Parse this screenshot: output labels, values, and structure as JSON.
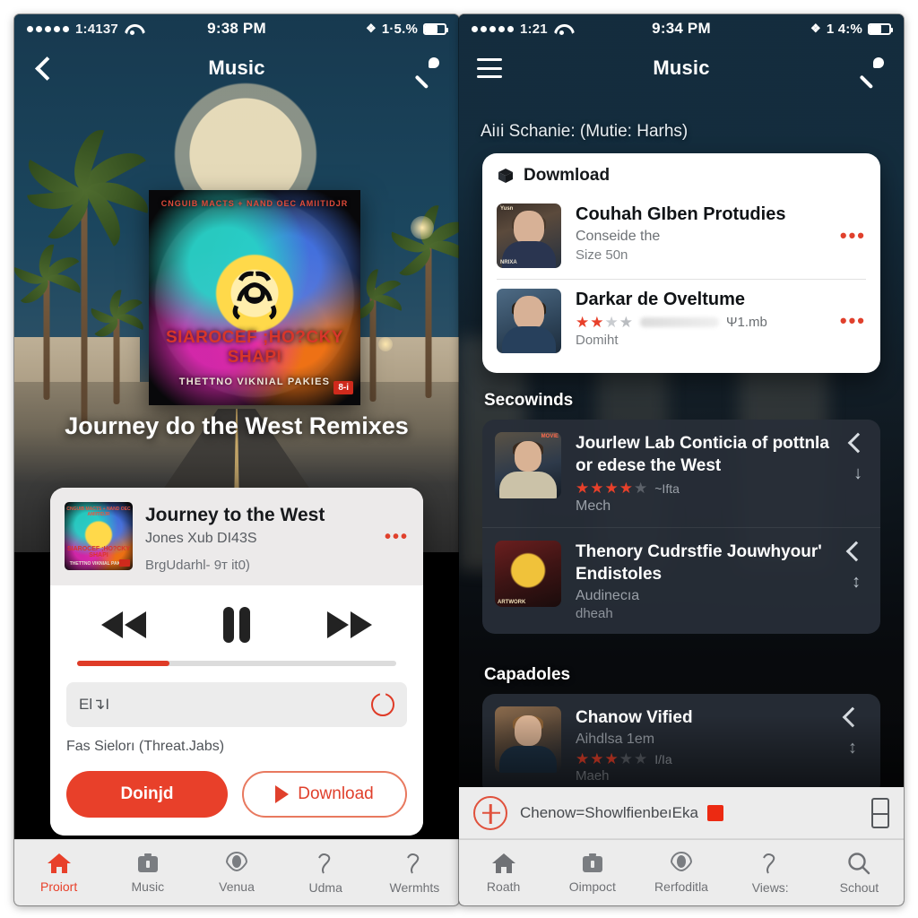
{
  "left": {
    "status": {
      "carrier": "1:4137",
      "time": "9:38 PM",
      "bluetooth": "bluetooth-icon",
      "battery_text": "1·5.%",
      "battery_level": 62
    },
    "nav": {
      "back": "back-icon",
      "title": "Music",
      "mic": "mic-icon"
    },
    "album": {
      "top_line": "CNGUIB MACTS + NAND OEC AMIITIDJR",
      "title_line": "SIAROCEF ;HO?CKY SHAPI",
      "sub_line": "THETTNO VIKNIAL PAKIES",
      "badge": "8-i"
    },
    "hero_title": "Journey do the West Remixes",
    "player": {
      "title": "Journey to the West",
      "subtitle": "Jones Xub DI43S",
      "third_line": "BrgUdarhl- 9т it0)",
      "more": "•••",
      "rewind": "rewind-icon",
      "pause": "pause-icon",
      "forward": "fast-forward-icon",
      "progress_percent": 29,
      "input_value": "El↴I",
      "power_icon": "power-icon",
      "caption": "Fas Sielorı (Threat.Jabs)",
      "primary_button": "Doinjd",
      "secondary_button": "Download"
    },
    "tabs": [
      {
        "label": "Proiort",
        "icon": "home-icon",
        "active": true
      },
      {
        "label": "Music",
        "icon": "briefcase-icon",
        "active": false
      },
      {
        "label": "Venua",
        "icon": "parachute-icon",
        "active": false
      },
      {
        "label": "Udma",
        "icon": "squiggle-icon",
        "active": false
      },
      {
        "label": "Wermhts",
        "icon": "squiggle-icon",
        "active": false
      }
    ]
  },
  "right": {
    "status": {
      "carrier": "1:21",
      "time": "9:34 PM",
      "bluetooth": "bluetooth-icon",
      "battery_text": "1 4:%",
      "battery_level": 58
    },
    "nav": {
      "menu": "hamburger-icon",
      "title": "Music",
      "mic": "mic-icon"
    },
    "caption": "Aiıi Schanie: (Mutie: Harhs)",
    "download_card": {
      "header": "Dowmload",
      "header_icon": "box-icon",
      "items": [
        {
          "title": "Couhah GIben Protudies",
          "sub": "Conseide the",
          "sub3": "Size 50n",
          "size": "",
          "stars": 0,
          "more": "•••",
          "thumb_tag": "Yusn",
          "thumb_tag2": "NRIXA"
        },
        {
          "title": "Darkar de Oveltume",
          "sub": "",
          "sub3": "Domiht",
          "size": "Ψ1.mb",
          "stars": 2,
          "more": "•••",
          "thumb_tag": "",
          "thumb_tag2": ""
        }
      ]
    },
    "sections": [
      {
        "title": "Secowinds",
        "items": [
          {
            "title": "Jourlew Lab Conticia of pottnla or edese the West",
            "sub": "Mech",
            "sub2": "",
            "stars": 4,
            "rating_text": "~Ifta",
            "thumb": "reporter-photo",
            "chev": "chevron-left-icon",
            "arrow": "↓"
          },
          {
            "title": "Thenory Cudrstfie Jouwhyour' Endistoles",
            "sub": "Audinecıa",
            "sub2": "dheah",
            "stars": 0,
            "rating_text": "",
            "thumb": "golden-deity-art",
            "chev": "chevron-left-icon",
            "arrow": "↕"
          }
        ]
      },
      {
        "title": "Capadoles",
        "items": [
          {
            "title": "Chanow Vified",
            "sub": "Aihdlsa 1em",
            "sub2": "Maeh",
            "stars": 3,
            "rating_text": "I/Ia",
            "thumb": "boy-portrait",
            "chev": "chevron-left-icon",
            "arrow": "↕"
          }
        ]
      }
    ],
    "miniplayer": {
      "icon": "add-circle-icon",
      "text": "Chenow=ShowlfienbeıΕka",
      "square": "stop-square",
      "right_icon": "battery-side-icon"
    },
    "tabs": [
      {
        "label": "Roath",
        "icon": "home-icon",
        "active": false
      },
      {
        "label": "Oimpoct",
        "icon": "briefcase-icon",
        "active": false
      },
      {
        "label": "Rerfoditla",
        "icon": "parachute-icon",
        "active": false
      },
      {
        "label": "Views:",
        "icon": "squiggle-icon",
        "active": false
      },
      {
        "label": "Schout",
        "icon": "search-icon",
        "active": false
      }
    ]
  },
  "colors": {
    "accent": "#e8402a",
    "navy": "#17394f",
    "dark_card": "#282e38"
  }
}
